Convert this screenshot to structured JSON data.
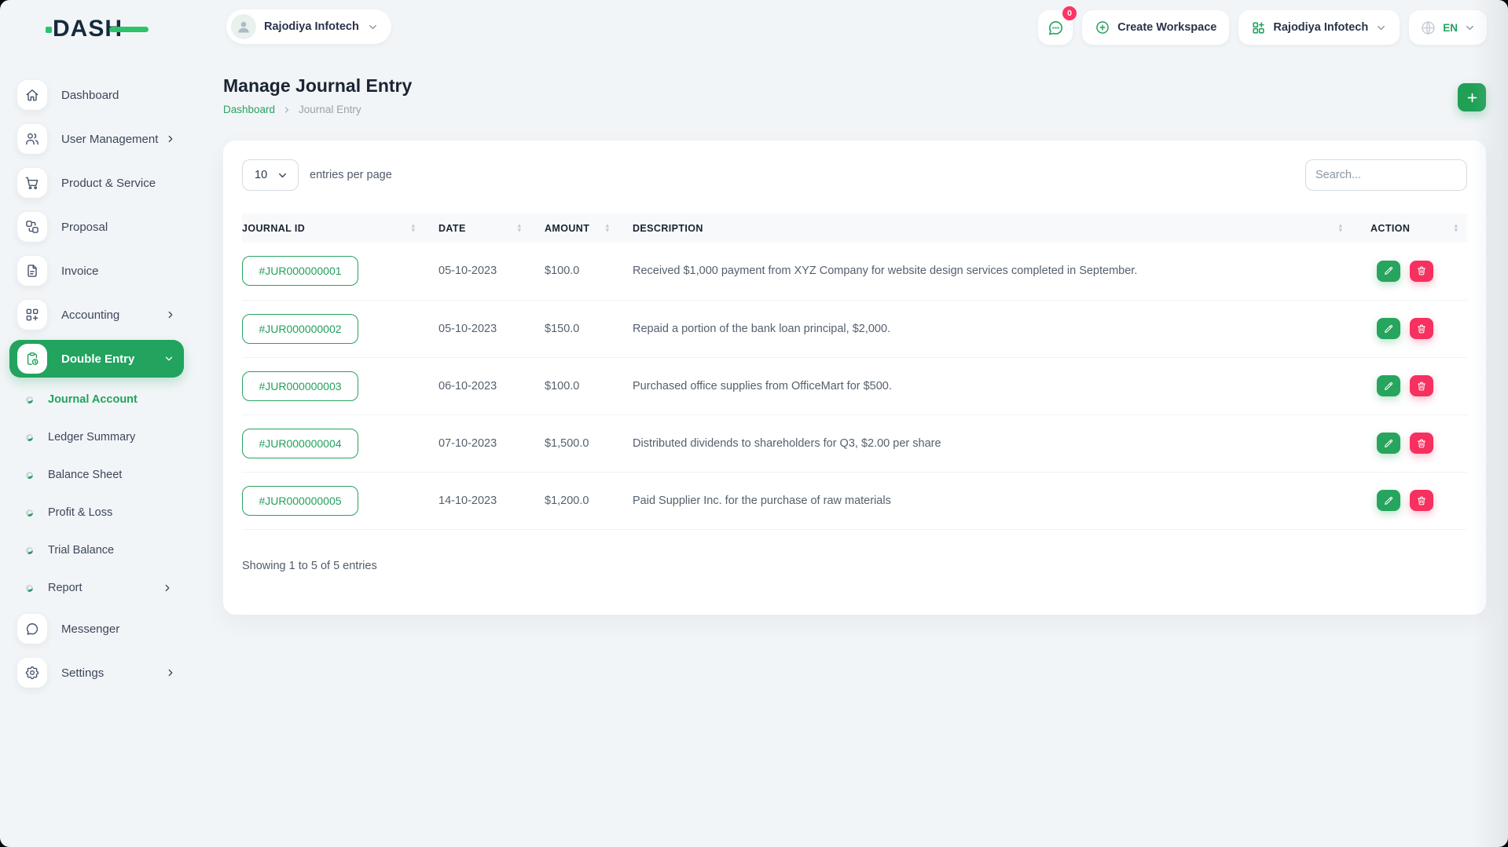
{
  "topbar": {
    "logo_text": "DASH",
    "workspace_pill": {
      "name": "Rajodiya Infotech"
    },
    "chat_badge": "0",
    "create_workspace_label": "Create Workspace",
    "company_pill": {
      "name": "Rajodiya Infotech"
    },
    "language_pill": {
      "code": "EN"
    }
  },
  "sidebar": {
    "items": [
      {
        "label": "Dashboard"
      },
      {
        "label": "User Management"
      },
      {
        "label": "Product & Service"
      },
      {
        "label": "Proposal"
      },
      {
        "label": "Invoice"
      },
      {
        "label": "Accounting"
      },
      {
        "label": "Double Entry"
      }
    ],
    "double_entry_sub": [
      {
        "label": "Journal Account"
      },
      {
        "label": "Ledger Summary"
      },
      {
        "label": "Balance Sheet"
      },
      {
        "label": "Profit & Loss"
      },
      {
        "label": "Trial Balance"
      },
      {
        "label": "Report"
      }
    ],
    "bottom_items": [
      {
        "label": "Messenger"
      },
      {
        "label": "Settings"
      }
    ]
  },
  "page": {
    "title": "Manage Journal Entry",
    "breadcrumb_home": "Dashboard",
    "breadcrumb_current": "Journal Entry"
  },
  "card": {
    "per_page_value": "10",
    "per_page_label": "entries per page",
    "search_placeholder": "Search...",
    "columns": [
      "JOURNAL ID",
      "DATE",
      "AMOUNT",
      "DESCRIPTION",
      "ACTION"
    ],
    "rows": [
      {
        "journal_id": "#JUR000000001",
        "date": "05-10-2023",
        "amount": "$100.0",
        "description": "Received $1,000 payment from XYZ Company for website design services completed in September."
      },
      {
        "journal_id": "#JUR000000002",
        "date": "05-10-2023",
        "amount": "$150.0",
        "description": "Repaid a portion of the bank loan principal, $2,000."
      },
      {
        "journal_id": "#JUR000000003",
        "date": "06-10-2023",
        "amount": "$100.0",
        "description": "Purchased office supplies from OfficeMart for $500."
      },
      {
        "journal_id": "#JUR000000004",
        "date": "07-10-2023",
        "amount": "$1,500.0",
        "description": "Distributed dividends to shareholders for Q3, $2.00 per share"
      },
      {
        "journal_id": "#JUR000000005",
        "date": "14-10-2023",
        "amount": "$1,200.0",
        "description": "Paid Supplier Inc. for the purchase of raw materials"
      }
    ],
    "summary": "Showing 1 to 5 of 5 entries"
  },
  "colors": {
    "primary_green": "#22a35e",
    "logo_green": "#2cc36b",
    "danger_pink": "#f6305f",
    "page_bg": "#f2f5f7"
  }
}
